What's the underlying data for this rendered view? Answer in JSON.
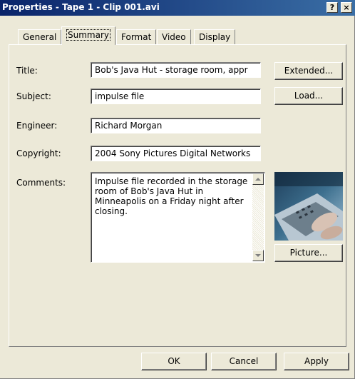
{
  "window": {
    "title": "Properties - Tape 1 - Clip 001.avi",
    "help_button": "?",
    "close_button": "×"
  },
  "tabs": [
    {
      "label": "General",
      "active": false
    },
    {
      "label": "Summary",
      "active": true
    },
    {
      "label": "Format",
      "active": false
    },
    {
      "label": "Video",
      "active": false
    },
    {
      "label": "Display",
      "active": false
    }
  ],
  "form": {
    "title": {
      "label": "Title:",
      "value": "Bob's Java Hut - storage room, appr"
    },
    "subject": {
      "label": "Subject:",
      "value": "impulse file"
    },
    "engineer": {
      "label": "Engineer:",
      "value": "Richard Morgan"
    },
    "copyright": {
      "label": "Copyright:",
      "value": "2004 Sony Pictures Digital Networks"
    },
    "comments": {
      "label": "Comments:",
      "value": "Impulse file recorded in the storage room of Bob's Java Hut in Minneapolis on a Friday night after closing."
    }
  },
  "side_buttons": {
    "extended": "Extended...",
    "load": "Load...",
    "picture": "Picture..."
  },
  "footer": {
    "ok": "OK",
    "cancel": "Cancel",
    "apply": "Apply"
  },
  "icons": {
    "help": "help-icon",
    "close": "close-icon",
    "scroll_up": "arrow-up-icon",
    "scroll_down": "arrow-down-icon"
  },
  "colors": {
    "titlebar_start": "#0a246a",
    "titlebar_end": "#3a6ea5",
    "dialog_bg": "#ece9d8"
  }
}
